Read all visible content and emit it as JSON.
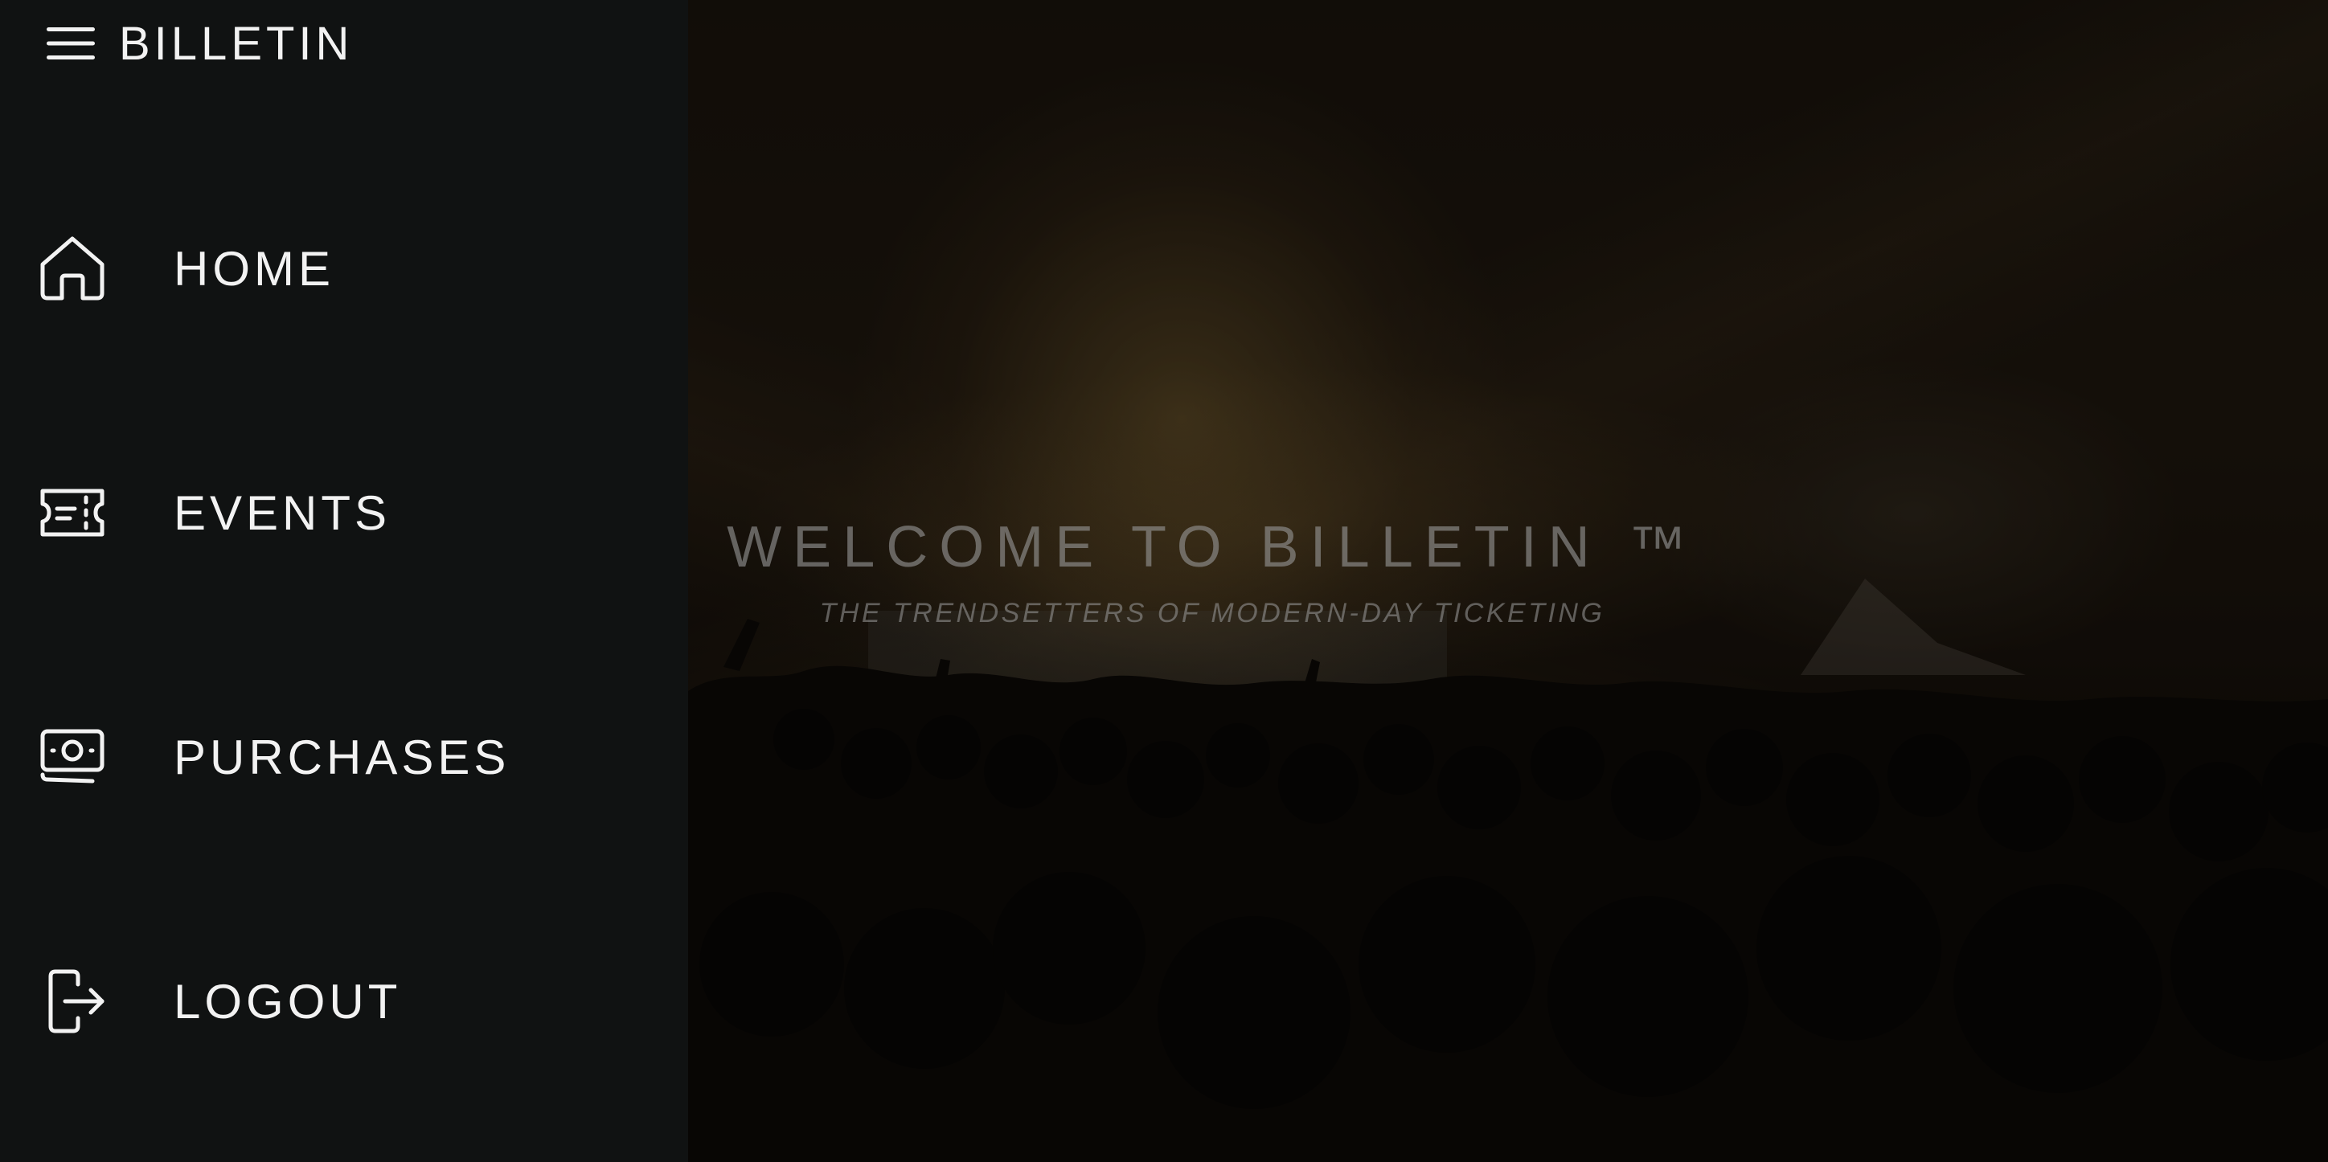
{
  "app": {
    "brand_name": "BILLETIN",
    "menu_icon": "hamburger-menu-icon"
  },
  "sidebar": {
    "items": [
      {
        "label": "HOME",
        "icon": "home-icon"
      },
      {
        "label": "EVENTS",
        "icon": "ticket-icon"
      },
      {
        "label": "PURCHASES",
        "icon": "money-icon"
      },
      {
        "label": "LOGOUT",
        "icon": "logout-icon"
      }
    ]
  },
  "hero": {
    "title": "WELCOME TO BILLETIN ™",
    "subtitle": "THE TRENDSETTERS OF MODERN-DAY TICKETING"
  },
  "colors": {
    "sidebar_bg": "#101212",
    "text": "#f2f2f2",
    "hero_text": "#969696"
  }
}
